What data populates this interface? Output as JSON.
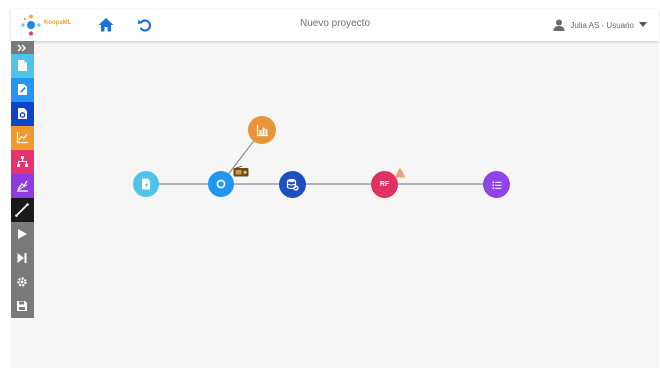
{
  "app": {
    "logo_text": "KoopaML",
    "project_title": "Nuevo proyecto",
    "user_label": "Julia AS - Usuario"
  },
  "header": {
    "home_icon": "home-icon",
    "undo_icon": "undo-icon",
    "user_icon": "user-icon",
    "dropdown_icon": "caret-down-icon"
  },
  "toolbar": {
    "items": [
      {
        "name": "expand",
        "icon": "double-chevron-icon",
        "color": "#7a7a7a"
      },
      {
        "name": "load-data",
        "icon": "document-icon",
        "color": "#4fc3e8"
      },
      {
        "name": "edit-data",
        "icon": "edit-icon",
        "color": "#2196f3"
      },
      {
        "name": "dataset",
        "icon": "file-gear-icon",
        "color": "#0d47c7"
      },
      {
        "name": "visualization",
        "icon": "chart-icon",
        "color": "#ef9a2e"
      },
      {
        "name": "model",
        "icon": "sitemap-icon",
        "color": "#e8336e"
      },
      {
        "name": "evaluate",
        "icon": "chart-layers-icon",
        "color": "#8e3be0"
      },
      {
        "name": "connect",
        "icon": "line-icon",
        "color": "#1a1a1a"
      },
      {
        "name": "run",
        "icon": "play-icon",
        "color": "#7a7a7a"
      },
      {
        "name": "run-step",
        "icon": "step-icon",
        "color": "#7a7a7a"
      },
      {
        "name": "settings",
        "icon": "gear-icon",
        "color": "#7a7a7a"
      },
      {
        "name": "save",
        "icon": "save-icon",
        "color": "#7a7a7a"
      }
    ]
  },
  "nodes": [
    {
      "name": "load-file",
      "icon": "file-icon",
      "color": "#4fc3e8",
      "label": ""
    },
    {
      "name": "preprocess",
      "icon": "circle-icon",
      "color": "#2196f3",
      "label": ""
    },
    {
      "name": "chart",
      "icon": "chart-icon",
      "color": "#e8943a",
      "label": ""
    },
    {
      "name": "database",
      "icon": "database-icon",
      "color": "#1f4fbf",
      "label": ""
    },
    {
      "name": "random-forest",
      "icon": "",
      "color": "#e0315f",
      "label": "RF"
    },
    {
      "name": "results",
      "icon": "list-icon",
      "color": "#8e44e8",
      "label": ""
    }
  ],
  "badges": {
    "warning_color": "#e8a07a",
    "connector_icon": "radio-icon"
  }
}
